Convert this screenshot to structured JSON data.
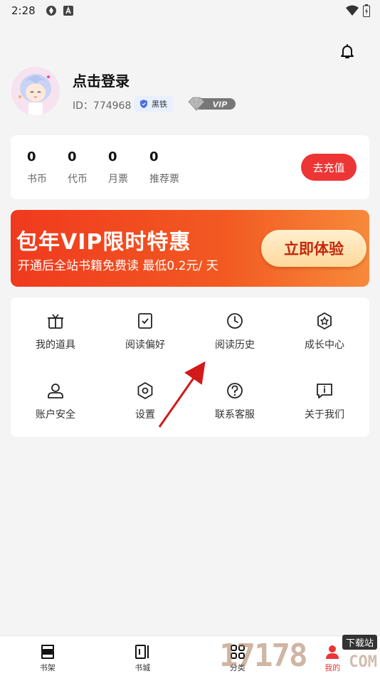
{
  "status_bar": {
    "time": "2:28"
  },
  "profile": {
    "login_text": "点击登录",
    "user_id": "ID：774968",
    "level_badge": "黑铁",
    "vip_badge": "VIP"
  },
  "wallet": {
    "items": [
      {
        "value": "0",
        "label": "书币"
      },
      {
        "value": "0",
        "label": "代币"
      },
      {
        "value": "0",
        "label": "月票"
      },
      {
        "value": "0",
        "label": "推荐票"
      }
    ],
    "recharge_label": "去充值"
  },
  "banner": {
    "title": "包年VIP限时特惠",
    "subtitle": "开通后全站书籍免费读 最低0.2元/ 天",
    "cta": "立即体验"
  },
  "menu": {
    "items": [
      {
        "label": "我的道具",
        "icon": "gift-box-icon"
      },
      {
        "label": "阅读偏好",
        "icon": "preference-check-icon"
      },
      {
        "label": "阅读历史",
        "icon": "clock-icon"
      },
      {
        "label": "成长中心",
        "icon": "star-badge-icon"
      },
      {
        "label": "账户安全",
        "icon": "user-icon"
      },
      {
        "label": "设置",
        "icon": "gear-icon"
      },
      {
        "label": "联系客服",
        "icon": "question-icon"
      },
      {
        "label": "关于我们",
        "icon": "info-icon"
      }
    ]
  },
  "tabbar": {
    "items": [
      {
        "label": "书架",
        "icon": "bookshelf-icon"
      },
      {
        "label": "书城",
        "icon": "book-store-icon"
      },
      {
        "label": "分类",
        "icon": "category-grid-icon"
      },
      {
        "label": "我的",
        "icon": "profile-icon"
      }
    ],
    "active": "我的"
  },
  "watermark": {
    "digits": "17178",
    "tag": "下载站",
    "domain": "COM"
  },
  "colors": {
    "accent": "#ee3535",
    "banner_start": "#f03a1e",
    "banner_end": "#f78a3a",
    "background": "#f4f4f4"
  }
}
